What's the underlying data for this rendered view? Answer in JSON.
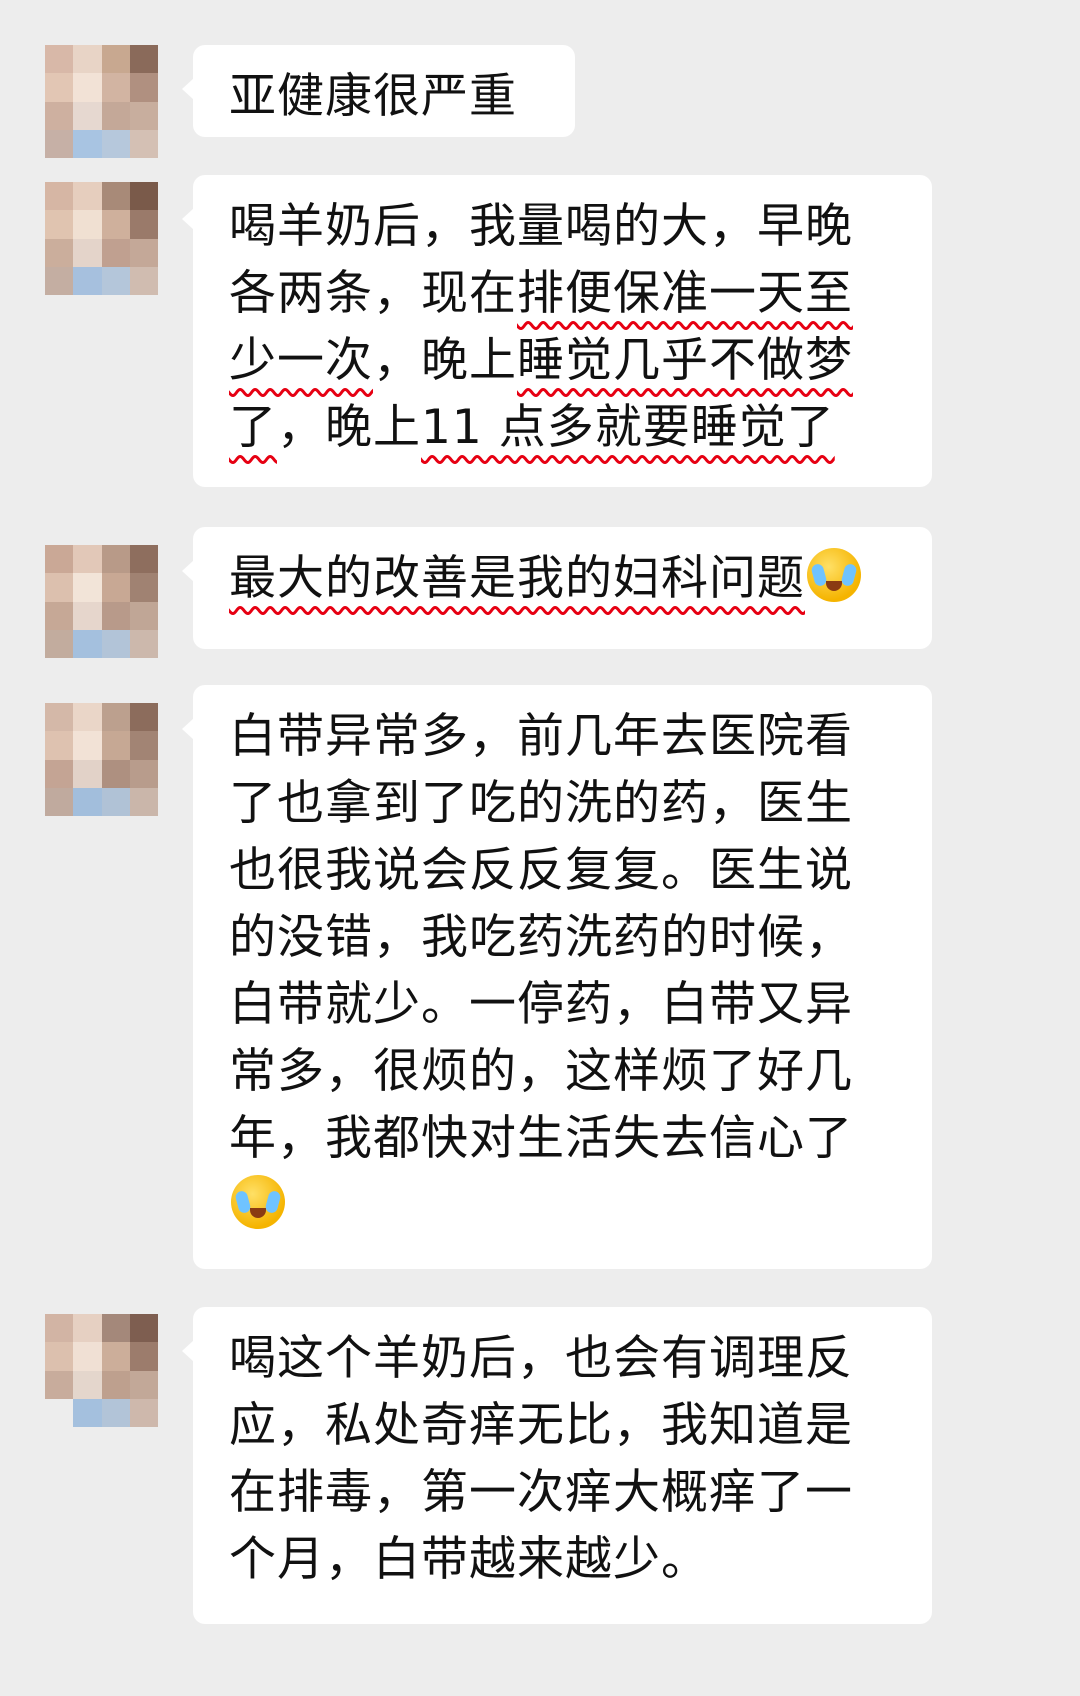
{
  "messages": [
    {
      "id": "m1",
      "segments": [
        {
          "text": "亚健康很严重",
          "wavy": false
        }
      ],
      "emoji": null
    },
    {
      "id": "m2",
      "segments": [
        {
          "text": "喝羊奶后，我量喝的大，早晚各两条，现在",
          "wavy": false
        },
        {
          "text": "排便保准一天至少一次",
          "wavy": true
        },
        {
          "text": "，晚上",
          "wavy": false
        },
        {
          "text": "睡觉几乎不做梦了",
          "wavy": true
        },
        {
          "text": "，晚上",
          "wavy": false
        },
        {
          "text": "11 点多就要睡觉了",
          "wavy": true
        }
      ],
      "emoji": null
    },
    {
      "id": "m3",
      "segments": [
        {
          "text": "最大的改善是我的妇科问题",
          "wavy": true
        }
      ],
      "emoji": "facepalm-crying-emoji"
    },
    {
      "id": "m4",
      "segments": [
        {
          "text": "白带异常多，前几年去医院看了也拿到了吃的洗的药，医生也很我说会反反复复。医生说的没错，我吃药洗药的时候，白带就少。一停药，白带又异常多，很烦的，这样烦了好几年，我都快对生活失去信心了",
          "wavy": false
        }
      ],
      "emoji": "facepalm-crying-emoji"
    },
    {
      "id": "m5",
      "segments": [
        {
          "text": "喝这个羊奶后，也会有调理反应，私处奇痒无比，我知道是在排毒，第一次痒大概痒了一个月，白带越来越少。",
          "wavy": false
        }
      ],
      "emoji": null
    }
  ],
  "colors": {
    "background": "#ededed",
    "bubble": "#ffffff",
    "text": "#111111",
    "underline": "#e60012"
  }
}
